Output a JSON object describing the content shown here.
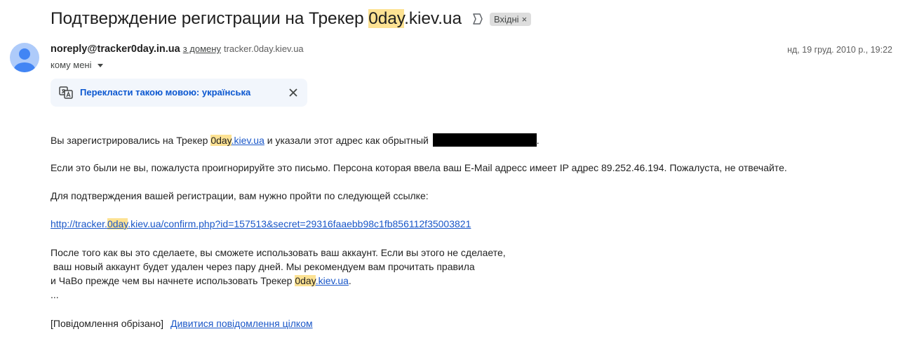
{
  "header": {
    "subject_before": "Подтверждение регистрации на Трекер ",
    "subject_highlight": "0day",
    "subject_after": ".kiev.ua",
    "label": "Вхідні",
    "label_close": "×",
    "important_icon": "importance-marker-icon"
  },
  "sender": {
    "email": "noreply@tracker0day.in.ua",
    "via_text": "з домену",
    "via_domain": "tracker.0day.kiev.ua",
    "date": "нд, 19 груд. 2010 р., 19:22",
    "recipient_text": "кому мені",
    "avatar_icon": "person-avatar-icon"
  },
  "translate_bar": {
    "text": "Перекласти такою мовою: українська",
    "icon": "translate-icon",
    "close_icon": "close-icon"
  },
  "body": {
    "line1_before": "Вы зарегистрировались на Трекер ",
    "line1_hl": "0day",
    "line1_link": ".kiev.ua",
    "line1_after": " и указали этот адрес как обрытный",
    "line1_end": ".",
    "line2": "Если это были не вы, пожалуста проигнорируйте это письмо. Персона которая ввела ваш E-Mail адресс имеет IP адрес 89.252.46.194. Пожалуста, не отвечайте.",
    "line3": "Для подтверждения вашей регистрации, вам нужно пройти по следующей ссылке:",
    "link_before": "http://tracker.",
    "link_hl": "0day",
    "link_after": ".kiev.ua/confirm.php?id=157513&secret=29316faaebb98c1fb856112f35003821",
    "para_line1": "После того как вы это сделаете, вы сможете использовать ваш аккаунт. Если вы этого не сделаете,",
    "para_line2": " ваш новый аккаунт будет удален через пару дней. Мы рекомендуем вам прочитать правила",
    "para_line3_before": "и ЧаВо прежде чем вы начнете использовать Трекер ",
    "para_line3_hl": "0day",
    "para_line3_link": ".kiev.ua",
    "para_line3_end": ".",
    "ellipsis": "...",
    "clipped_text": "[Повідомлення обрізано]",
    "view_full_link": "Дивитися повідомлення цілком"
  },
  "colors": {
    "highlight": "#fde293",
    "link": "#1a57c8",
    "translate_bg": "#f2f6fc",
    "avatar_bg": "#aecbfa"
  }
}
